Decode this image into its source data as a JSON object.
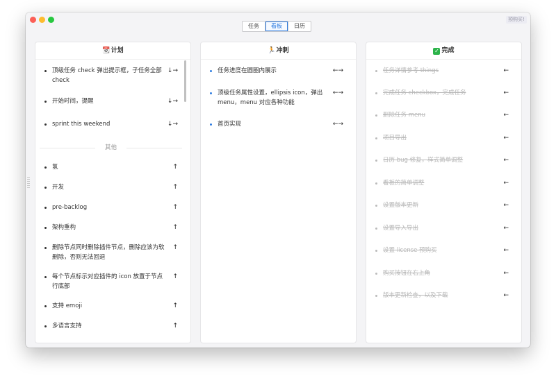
{
  "toolbar": {
    "tabs": [
      {
        "label": "任务"
      },
      {
        "label": "看板"
      },
      {
        "label": "日历"
      }
    ],
    "active_tab": "看板",
    "buy_label": "预购买!"
  },
  "columns": {
    "plan": {
      "icon": "📆",
      "title": "计划",
      "items": [
        {
          "text": "顶级任务 check 弹出提示框，子任务全部 check",
          "arrows": "↓→"
        },
        {
          "text": "开始时间，提醒",
          "arrows": "↓→"
        },
        {
          "text": "sprint this weekend",
          "arrows": "↓→"
        }
      ],
      "divider_label": "其他",
      "others": [
        {
          "text": "氢",
          "arrows": "↑"
        },
        {
          "text": "开发",
          "arrows": "↑"
        },
        {
          "text": "pre-backlog",
          "arrows": "↑"
        },
        {
          "text": "架构重构",
          "arrows": "↑"
        },
        {
          "text": "删除节点同时删除插件节点，删除应该为软删除，否则无法回退",
          "arrows": "↑"
        },
        {
          "text": "每个节点标示对应插件的 icon 放置于节点行底部",
          "arrows": "↑"
        },
        {
          "text": "支持 emoji",
          "arrows": "↑"
        },
        {
          "text": "多语言支持",
          "arrows": "↑"
        }
      ]
    },
    "sprint": {
      "icon": "🏃",
      "title": "冲刺",
      "items": [
        {
          "text": "任务进度在圆圈内展示",
          "arrows": "←→"
        },
        {
          "text": "顶级任务属性设置，ellipsis icon，弹出 menu，menu 对应各种功能",
          "arrows": "←→"
        },
        {
          "text": "首页实现",
          "arrows": "←→"
        }
      ]
    },
    "done": {
      "icon": "✓",
      "title": "完成",
      "items": [
        {
          "text": "任务详情参考 things",
          "arrows": "←"
        },
        {
          "text": "完成任务 checkbox，完成任务",
          "arrows": "←"
        },
        {
          "text": "删除任务 menu",
          "arrows": "←"
        },
        {
          "text": "项目导出",
          "arrows": "←"
        },
        {
          "text": "日历 bug 修复，样式简单调整",
          "arrows": "←"
        },
        {
          "text": "看板的简单调整",
          "arrows": "←"
        },
        {
          "text": "设置版本更新",
          "arrows": "←"
        },
        {
          "text": "设置导入导出",
          "arrows": "←"
        },
        {
          "text": "设置 license 预购买",
          "arrows": "←"
        },
        {
          "text": "购买按钮在右上角",
          "arrows": "←"
        },
        {
          "text": "版本更新检查，以及下载",
          "arrows": "←"
        }
      ]
    }
  },
  "colors": {
    "accent": "#2f7de1",
    "close": "#fc5f57",
    "minimize": "#fdbc2e",
    "zoom": "#28c840"
  }
}
